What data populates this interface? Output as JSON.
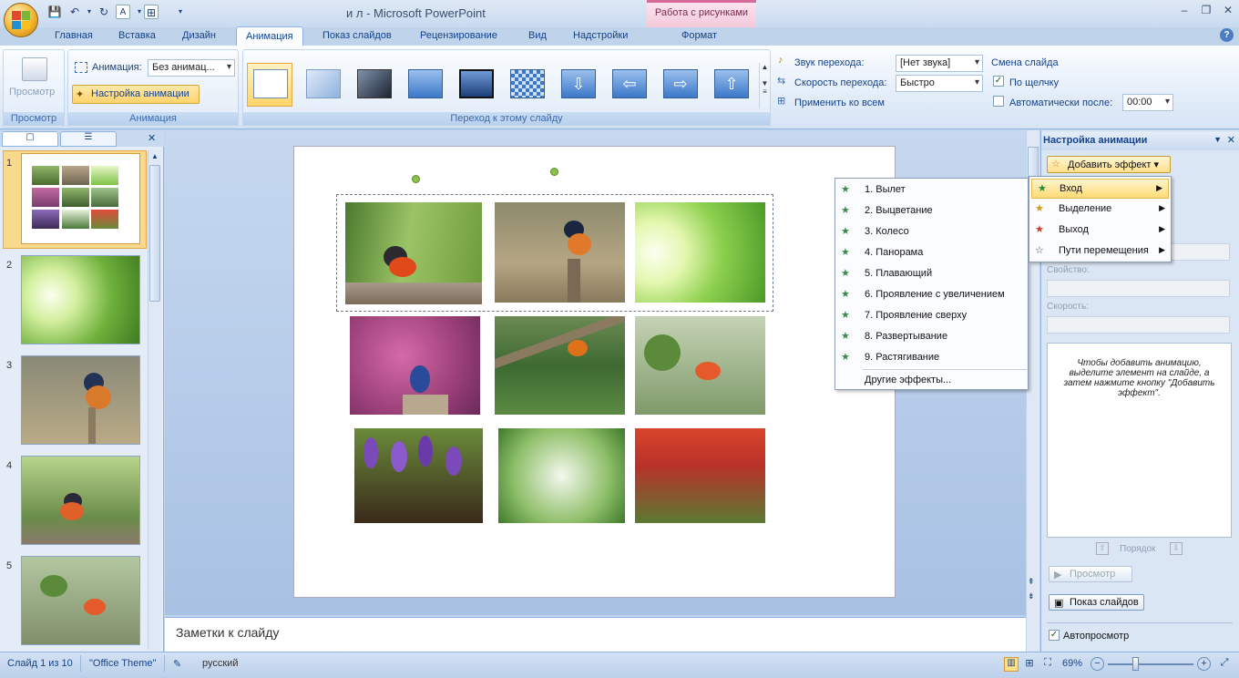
{
  "window": {
    "title": "и л - Microsoft PowerPoint",
    "context_group": "Работа с рисунками"
  },
  "tabs": [
    "Главная",
    "Вставка",
    "Дизайн",
    "Анимация",
    "Показ слайдов",
    "Рецензирование",
    "Вид",
    "Надстройки",
    "Формат"
  ],
  "ribbon": {
    "preview_label": "Просмотр",
    "preview_group": "Просмотр",
    "animation_label": "Анимация:",
    "animation_value": "Без анимац...",
    "custom_anim_label": "Настройка анимации",
    "anim_group": "Анимация",
    "sound_label": "Звук перехода:",
    "sound_value": "[Нет звука]",
    "speed_label": "Скорость перехода:",
    "speed_value": "Быстро",
    "apply_all": "Применить ко всем",
    "advance_title": "Смена слайда",
    "on_click": "По щелчку",
    "auto_after": "Автоматически после:",
    "auto_time": "00:00",
    "transition_group": "Переход к этому слайду"
  },
  "slides_pane": {
    "numbers": [
      "1",
      "2",
      "3",
      "4",
      "5"
    ]
  },
  "notes_placeholder": "Заметки к слайду",
  "effects_menu": {
    "items": [
      "1. Вылет",
      "2. Выцветание",
      "3. Колесо",
      "4. Панорама",
      "5. Плавающий",
      "6. Проявление с увеличением",
      "7. Проявление сверху",
      "8. Развертывание",
      "9. Растягивание"
    ],
    "more": "Другие эффекты..."
  },
  "add_effect_menu": {
    "items": [
      "Вход",
      "Выделение",
      "Выход",
      "Пути перемещения"
    ]
  },
  "task_pane": {
    "title": "Настройка анимации",
    "add_effect": "Добавить эффект",
    "property": "Свойство:",
    "speed": "Скорость:",
    "info": "Чтобы добавить анимацию, выделите элемент на слайде, а затем нажмите кнопку \"Добавить эффект\".",
    "order": "Порядок",
    "play": "Просмотр",
    "slideshow": "Показ слайдов",
    "autopreview": "Автопросмотр"
  },
  "status": {
    "slide": "Слайд 1 из 10",
    "theme": "\"Office Theme\"",
    "lang": "русский",
    "zoom": "69%"
  },
  "colors": {
    "accent": "#15428b",
    "ribbon_bg": "#dbe8f7",
    "selection": "#ffdb75"
  }
}
